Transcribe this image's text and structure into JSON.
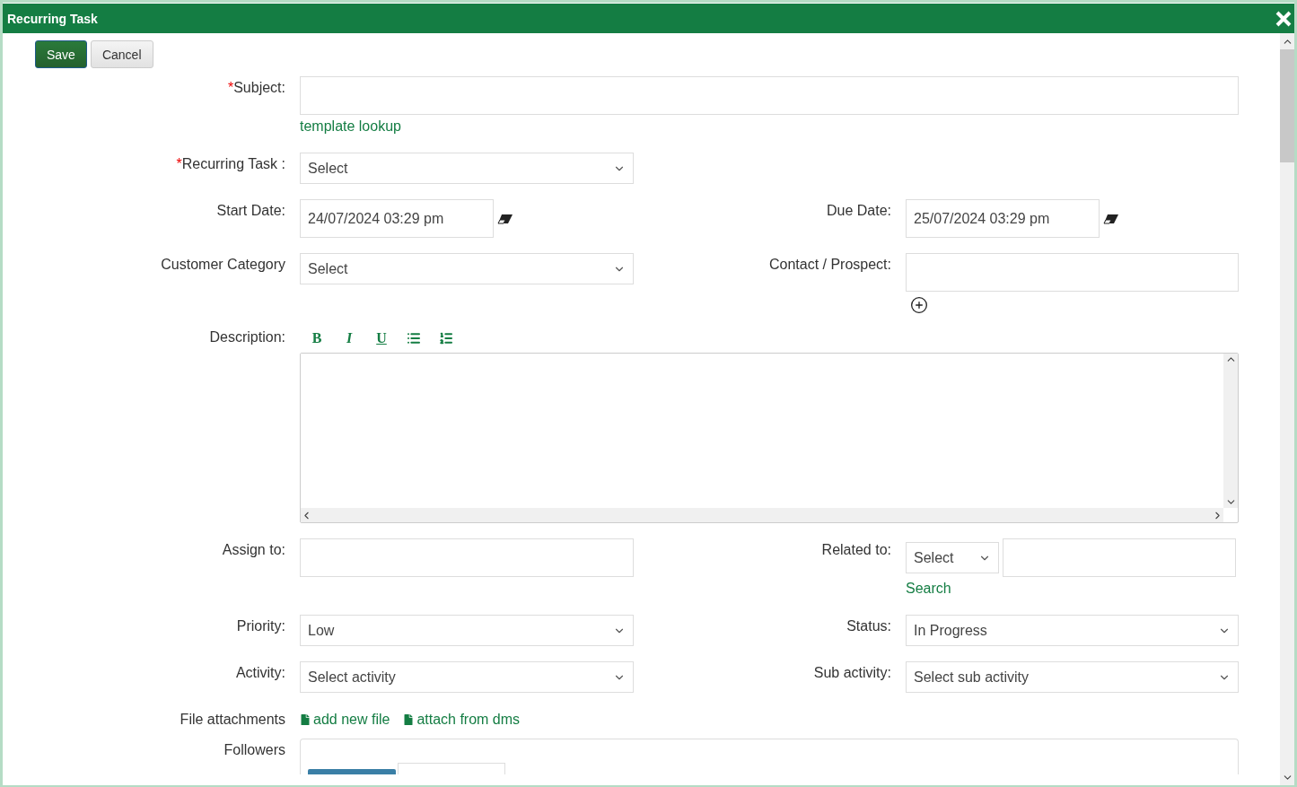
{
  "window": {
    "title": "Recurring Task"
  },
  "actions": [
    {
      "label": "Save",
      "kind": "primary"
    },
    {
      "label": "Cancel",
      "kind": "secondary"
    }
  ],
  "subject": {
    "label": "Subject:",
    "required": true,
    "mark": "*",
    "link": "template lookup"
  },
  "recurring_task": {
    "label": "Recurring Task :",
    "required": true,
    "mark": "*",
    "value": "Select"
  },
  "start_date": {
    "label": "Start Date:",
    "value": "24/07/2024 03:29 pm"
  },
  "due_date": {
    "label": "Due Date:",
    "value": "25/07/2024 03:29 pm"
  },
  "customer_category": {
    "label": "Customer Category",
    "value": "Select"
  },
  "contact": {
    "label": "Contact / Prospect:"
  },
  "description": {
    "label": "Description:",
    "toolbar": [
      {
        "kind": "bold",
        "label": "B"
      },
      {
        "kind": "italic",
        "label": "I"
      },
      {
        "kind": "underline",
        "label": "U"
      },
      {
        "kind": "bullets"
      },
      {
        "kind": "numbered"
      }
    ]
  },
  "assign_to": {
    "label": "Assign to:"
  },
  "related_to": {
    "label": "Related to:",
    "value": "Select",
    "link": "Search"
  },
  "priority": {
    "label": "Priority:",
    "value": "Low"
  },
  "status": {
    "label": "Status:",
    "value": "In Progress"
  },
  "activity": {
    "label": "Activity:",
    "value": "Select activity"
  },
  "sub_activity": {
    "label": "Sub activity:",
    "value": "Select sub activity"
  },
  "attachments": {
    "label": "File attachments",
    "links": [
      "add new file",
      "attach from dms"
    ]
  },
  "followers": {
    "label": "Followers",
    "tags": [
      {
        "kind": "tag"
      }
    ]
  }
}
